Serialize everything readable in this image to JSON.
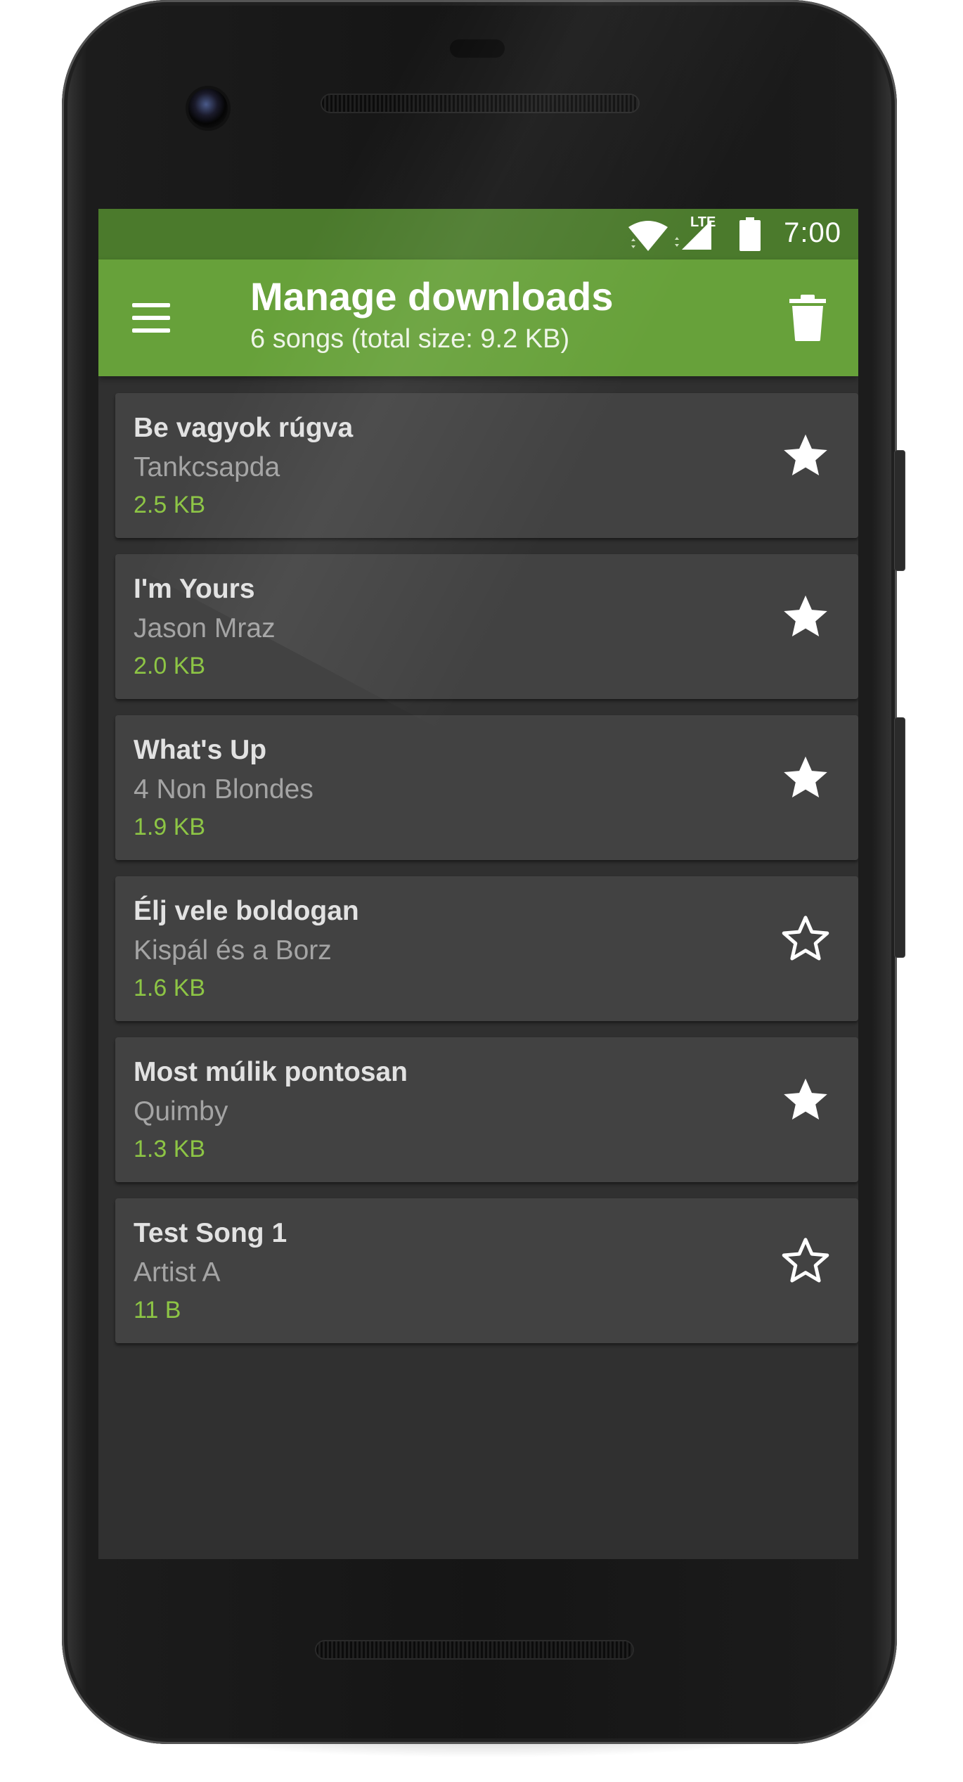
{
  "status_bar": {
    "time": "7:00",
    "network_label": "LTE",
    "icons": [
      "wifi-icon",
      "signal-icon",
      "battery-icon"
    ]
  },
  "app_bar": {
    "title": "Manage downloads",
    "subtitle": "6 songs (total size: 9.2 KB)",
    "menu_icon": "hamburger-menu-icon",
    "delete_icon": "trash-icon"
  },
  "colors": {
    "status_bar": "#4b7a2c",
    "app_bar": "#67a13a",
    "background": "#303030",
    "card": "#424242",
    "size_text": "#8dc545"
  },
  "songs": [
    {
      "title": "Be vagyok rúgva",
      "artist": "Tankcsapda",
      "size": "2.5 KB",
      "starred": true
    },
    {
      "title": "I'm Yours",
      "artist": "Jason Mraz",
      "size": "2.0 KB",
      "starred": true
    },
    {
      "title": "What's Up",
      "artist": "4 Non Blondes",
      "size": "1.9 KB",
      "starred": true
    },
    {
      "title": "Élj vele boldogan",
      "artist": "Kispál és a Borz",
      "size": "1.6 KB",
      "starred": false
    },
    {
      "title": "Most múlik pontosan",
      "artist": "Quimby",
      "size": "1.3 KB",
      "starred": true
    },
    {
      "title": "Test Song 1",
      "artist": "Artist A",
      "size": "11 B",
      "starred": false
    }
  ]
}
